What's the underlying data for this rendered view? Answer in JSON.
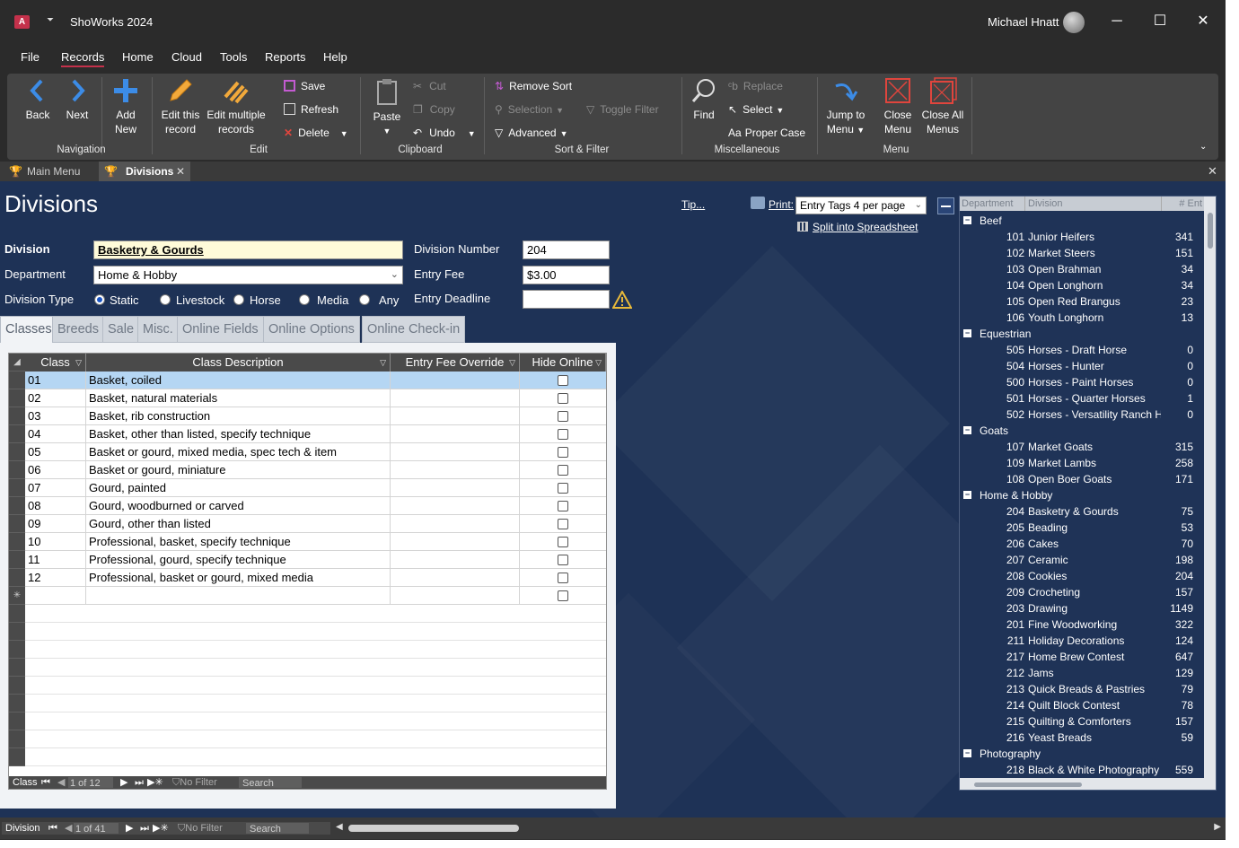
{
  "window": {
    "app_title": "ShoWorks 2024",
    "user": "Michael Hnatt",
    "qa_glyph": "⏷",
    "minimize": "─",
    "maximize": "☐",
    "close": "✕"
  },
  "menu": [
    "File",
    "Records",
    "Home",
    "Cloud",
    "Tools",
    "Reports",
    "Help"
  ],
  "ribbon": {
    "back": "Back",
    "next": "Next",
    "add_new_1": "Add",
    "add_new_2": "New",
    "edit_record_1": "Edit this",
    "edit_record_2": "record",
    "edit_multi_1": "Edit multiple",
    "edit_multi_2": "records",
    "save": "Save",
    "refresh": "Refresh",
    "delete": "Delete",
    "paste": "Paste",
    "cut": "Cut",
    "copy": "Copy",
    "undo": "Undo",
    "remove_sort": "Remove Sort",
    "selection": "Selection",
    "toggle_filter": "Toggle Filter",
    "advanced": "Advanced",
    "find": "Find",
    "replace": "Replace",
    "select": "Select",
    "proper_case": "Proper Case",
    "jump_menu_1": "Jump to",
    "jump_menu_2": "Menu",
    "close_menu_1": "Close",
    "close_menu_2": "Menu",
    "close_all_1": "Close All",
    "close_all_2": "Menus",
    "groups": {
      "navigation": "Navigation",
      "edit": "Edit",
      "clipboard": "Clipboard",
      "sort_filter": "Sort & Filter",
      "misc": "Miscellaneous",
      "menu": "Menu"
    }
  },
  "doctabs": {
    "main_menu": "Main Menu",
    "divisions": "Divisions"
  },
  "form": {
    "title": "Divisions",
    "tip": "Tip...",
    "print_label": "Print:",
    "print_value": "Entry Tags 4 per page",
    "split": "Split into Spreadsheet",
    "division_label": "Division",
    "division_value": "Basketry & Gourds",
    "department_label": "Department",
    "department_value": "Home & Hobby",
    "division_type_label": "Division Type",
    "types": [
      "Static",
      "Livestock",
      "Horse",
      "Media",
      "Any"
    ],
    "division_number_label": "Division Number",
    "division_number_value": "204",
    "entry_fee_label": "Entry Fee",
    "entry_fee_value": "$3.00",
    "entry_deadline_label": "Entry Deadline",
    "entry_deadline_value": ""
  },
  "subtabs": [
    "Classes",
    "Breeds",
    "Sale",
    "Misc.",
    "Online Fields",
    "Online Options",
    "Online Check-in"
  ],
  "grid": {
    "headers": [
      "Class",
      "Class Description",
      "Entry Fee Override",
      "Hide Online"
    ],
    "rows": [
      {
        "c": "01",
        "d": "Basket, coiled"
      },
      {
        "c": "02",
        "d": "Basket, natural materials"
      },
      {
        "c": "03",
        "d": "Basket, rib construction"
      },
      {
        "c": "04",
        "d": "Basket, other than listed, specify technique"
      },
      {
        "c": "05",
        "d": "Basket or gourd, mixed media, spec tech & item"
      },
      {
        "c": "06",
        "d": "Basket or gourd, miniature"
      },
      {
        "c": "07",
        "d": "Gourd, painted"
      },
      {
        "c": "08",
        "d": "Gourd, woodburned or carved"
      },
      {
        "c": "09",
        "d": "Gourd, other than listed"
      },
      {
        "c": "10",
        "d": "Professional, basket, specify technique"
      },
      {
        "c": "11",
        "d": "Professional, gourd, specify technique"
      },
      {
        "c": "12",
        "d": "Professional, basket or gourd, mixed media"
      }
    ],
    "new_marker": "✳",
    "nav": {
      "label": "Class",
      "position": "1 of 12",
      "filter": "No Filter",
      "search": "Search"
    }
  },
  "tree": {
    "headers": [
      "Department",
      "Division",
      "# Ent"
    ],
    "groups": [
      {
        "name": "Beef",
        "items": [
          [
            "101",
            "Junior Heifers",
            "341"
          ],
          [
            "102",
            "Market Steers",
            "151"
          ],
          [
            "103",
            "Open Brahman",
            "34"
          ],
          [
            "104",
            "Open Longhorn",
            "34"
          ],
          [
            "105",
            "Open Red Brangus",
            "23"
          ],
          [
            "106",
            "Youth Longhorn",
            "13"
          ]
        ]
      },
      {
        "name": "Equestrian",
        "items": [
          [
            "505",
            "Horses - Draft Horse",
            "0"
          ],
          [
            "504",
            "Horses - Hunter",
            "0"
          ],
          [
            "500",
            "Horses - Paint Horses",
            "0"
          ],
          [
            "501",
            "Horses - Quarter Horses",
            "1"
          ],
          [
            "502",
            "Horses - Versatility Ranch H...",
            "0"
          ]
        ]
      },
      {
        "name": "Goats",
        "items": [
          [
            "107",
            "Market Goats",
            "315"
          ],
          [
            "109",
            "Market Lambs",
            "258"
          ],
          [
            "108",
            "Open Boer Goats",
            "171"
          ]
        ]
      },
      {
        "name": "Home & Hobby",
        "items": [
          [
            "204",
            "Basketry & Gourds",
            "75"
          ],
          [
            "205",
            "Beading",
            "53"
          ],
          [
            "206",
            "Cakes",
            "70"
          ],
          [
            "207",
            "Ceramic",
            "198"
          ],
          [
            "208",
            "Cookies",
            "204"
          ],
          [
            "209",
            "Crocheting",
            "157"
          ],
          [
            "203",
            "Drawing",
            "1149"
          ],
          [
            "201",
            "Fine Woodworking",
            "322"
          ],
          [
            "211",
            "Holiday Decorations",
            "124"
          ],
          [
            "217",
            "Home Brew Contest",
            "647"
          ],
          [
            "212",
            "Jams",
            "129"
          ],
          [
            "213",
            "Quick Breads & Pastries",
            "79"
          ],
          [
            "214",
            "Quilt Block Contest",
            "78"
          ],
          [
            "215",
            "Quilting & Comforters",
            "157"
          ],
          [
            "216",
            "Yeast Breads",
            "59"
          ]
        ]
      },
      {
        "name": "Photography",
        "items": [
          [
            "218",
            "Black & White Photography",
            "559"
          ]
        ]
      }
    ]
  },
  "bottomnav": {
    "label": "Division",
    "position": "1 of 41",
    "filter": "No Filter",
    "search": "Search"
  }
}
